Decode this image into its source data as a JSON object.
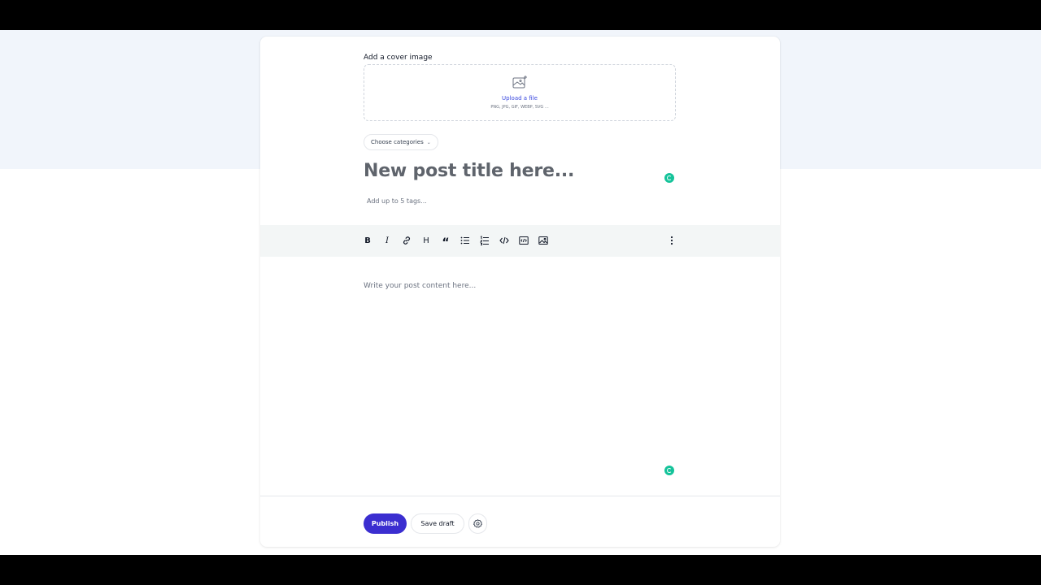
{
  "editor": {
    "cover_label": "Add a cover image",
    "upload_link": "Upload a file",
    "upload_hint": "PNG, JPG, GIF, WEBP, SVG ...",
    "categories_label": "Choose categories",
    "title_placeholder": "New post title here...",
    "tags_placeholder": "Add up to 5 tags...",
    "content_placeholder": "Write your post content here..."
  },
  "toolbar": {
    "items": [
      {
        "name": "bold",
        "label": "B"
      },
      {
        "name": "italic",
        "label": "I"
      },
      {
        "name": "link",
        "icon": "link-icon"
      },
      {
        "name": "heading",
        "label": "H"
      },
      {
        "name": "quote",
        "label": "“"
      },
      {
        "name": "bullet-list",
        "icon": "bullet-list-icon"
      },
      {
        "name": "ordered-list",
        "icon": "ordered-list-icon"
      },
      {
        "name": "code",
        "icon": "code-icon"
      },
      {
        "name": "code-block",
        "icon": "code-block-icon"
      },
      {
        "name": "image",
        "icon": "image-icon"
      },
      {
        "name": "more",
        "icon": "more-vertical-icon"
      }
    ]
  },
  "footer": {
    "publish_label": "Publish",
    "save_draft_label": "Save draft"
  },
  "colors": {
    "primary": "#3b2ed0",
    "grammarly": "#15c39a",
    "toolbar_bg": "#f3f6f6",
    "page_band": "#f1f5fb"
  }
}
